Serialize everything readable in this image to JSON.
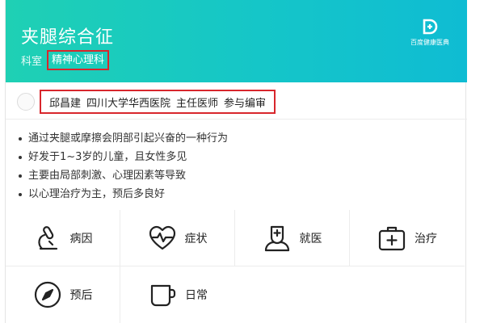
{
  "header": {
    "title": "夹腿综合征",
    "dept_label": "科室",
    "dept_name": "精神心理科",
    "logo_text": "百度健康医典",
    "accent": "#15c6c8",
    "highlight": "#d8262c"
  },
  "author": {
    "name": "邱昌建",
    "hospital": "四川大学华西医院",
    "title": "主任医师",
    "role": "参与编审"
  },
  "bullets": [
    "通过夹腿或摩擦会阴部引起兴奋的一种行为",
    "好发于1~3岁的儿童，且女性多见",
    "主要由局部刺激、心理因素等导致",
    "以心理治疗为主，预后多良好"
  ],
  "grid": [
    {
      "label": "病因",
      "icon": "microscope-icon"
    },
    {
      "label": "症状",
      "icon": "heart-pulse-icon"
    },
    {
      "label": "就医",
      "icon": "doctor-icon"
    },
    {
      "label": "治疗",
      "icon": "medical-kit-icon"
    },
    {
      "label": "预后",
      "icon": "compass-icon"
    },
    {
      "label": "日常",
      "icon": "mug-icon"
    }
  ]
}
